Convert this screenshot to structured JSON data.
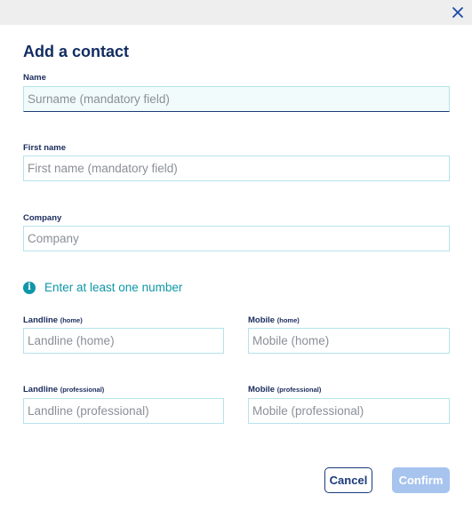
{
  "dialog": {
    "title": "Add a contact",
    "close_icon": "close-icon"
  },
  "fields": {
    "name": {
      "label": "Name",
      "placeholder": "Surname (mandatory field)",
      "value": ""
    },
    "first_name": {
      "label": "First name",
      "placeholder": "First name (mandatory field)",
      "value": ""
    },
    "company": {
      "label": "Company",
      "placeholder": "Company",
      "value": ""
    },
    "landline_home": {
      "label": "Landline",
      "sub": "(home)",
      "placeholder": "Landline (home)",
      "value": ""
    },
    "mobile_home": {
      "label": "Mobile",
      "sub": "(home)",
      "placeholder": "Mobile (home)",
      "value": ""
    },
    "landline_pro": {
      "label": "Landline",
      "sub": "(professional)",
      "placeholder": "Landline (professional)",
      "value": ""
    },
    "mobile_pro": {
      "label": "Mobile",
      "sub": "(professional)",
      "placeholder": "Mobile (professional)",
      "value": ""
    }
  },
  "info": {
    "icon": "info-icon",
    "glyph": "i",
    "text": "Enter at least one number"
  },
  "buttons": {
    "cancel": "Cancel",
    "confirm": "Confirm"
  },
  "colors": {
    "title": "#122c62",
    "accent": "#0d97a8",
    "field_border": "#b6e3eb",
    "confirm_disabled": "#a7c4ee"
  }
}
